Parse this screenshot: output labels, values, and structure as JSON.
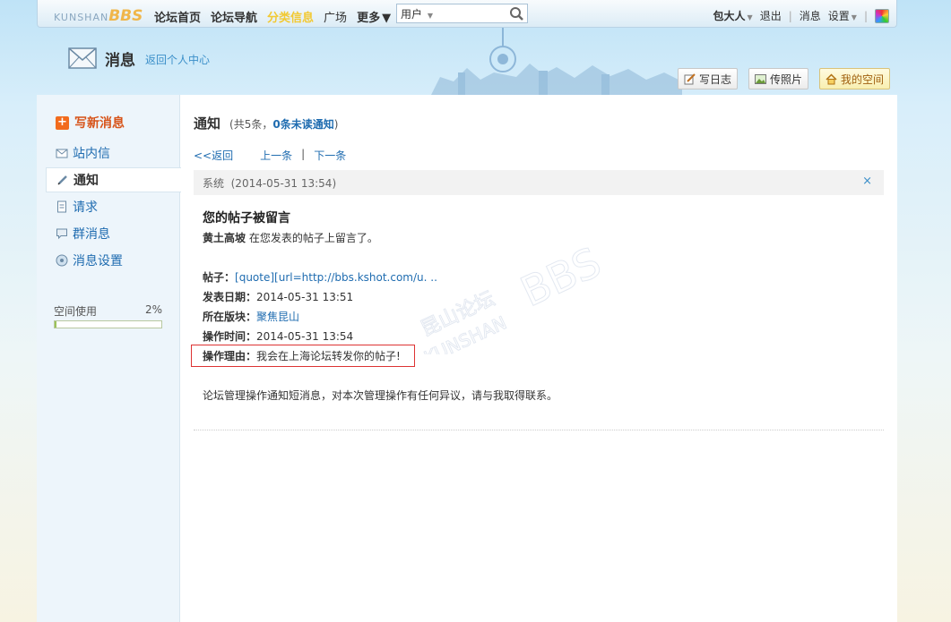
{
  "topbar": {
    "logo_small": "KUNSHAN",
    "logo_big": "BBS",
    "nav": [
      "论坛首页",
      "论坛导航",
      "分类信息",
      "广场",
      "更多"
    ],
    "search_select": "用户",
    "search_value": "",
    "user_name": "包大人",
    "logout": "退出",
    "messages": "消息",
    "settings": "设置",
    "icons": [
      "search-icon",
      "palette-icon"
    ]
  },
  "header": {
    "title": "消息",
    "back_link": "返回个人中心",
    "buttons": {
      "blog": "写日志",
      "photo": "传照片",
      "space": "我的空间"
    }
  },
  "sidebar": {
    "compose": "写新消息",
    "items": [
      "站内信",
      "通知",
      "请求",
      "群消息",
      "消息设置"
    ],
    "active_item": "通知",
    "space_label": "空间使用",
    "space_percent_text": "2%",
    "space_used_fraction": 0.02
  },
  "content": {
    "title": "通知",
    "meta_prefix": "(共5条，",
    "meta_unread": "0条未读通知",
    "meta_suffix": ")",
    "back": "<<返回",
    "prev": "上一条",
    "pager_sep": "|",
    "next": "下一条",
    "notice_head": "系统  (2014-05-31 13:54)",
    "close": "×",
    "notice_title": "您的帖子被留言",
    "user": "黄土高坡",
    "action": " 在您发表的帖子上留言了。",
    "post_label": "帖子：",
    "post_value": "[quote][url=http://bbs.kshot.com/u. ..",
    "date_label": "发表日期：",
    "date_value": "2014-05-31 13:51",
    "board_label": "所在版块：",
    "board_value": "聚焦昆山",
    "optime_label": "操作时间：",
    "optime_value": "2014-05-31 13:54",
    "reason_label": "操作理由：",
    "reason_value": "我会在上海论坛转发你的帖子!",
    "footer": "论坛管理操作通知短消息，对本次管理操作有任何异议，请与我取得联系。",
    "watermark_text": [
      "昆山论坛",
      "KUNSHAN",
      "BBS"
    ]
  }
}
